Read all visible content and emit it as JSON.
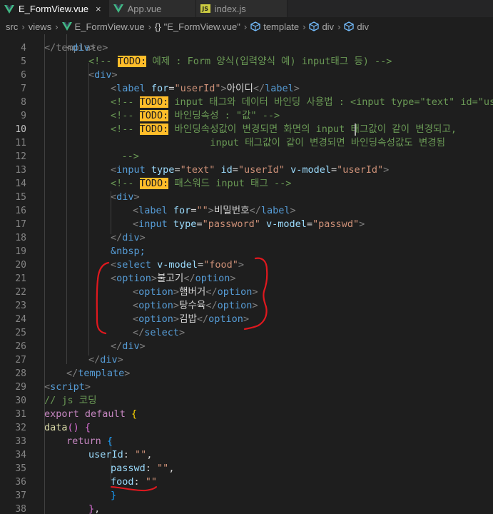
{
  "tabs": [
    {
      "label": "E_FormView.vue",
      "active": true,
      "icon": "vue-icon"
    },
    {
      "label": "App.vue",
      "active": false,
      "icon": "vue-icon"
    },
    {
      "label": "index.js",
      "active": false,
      "icon": "js-icon"
    }
  ],
  "js_badge": "JS",
  "close_glyph": "×",
  "breadcrumb": [
    "src",
    "views",
    "E_FormView.vue",
    "\"E_FormView.vue\"",
    "template",
    "div",
    "div"
  ],
  "breadcrumb_sep": "›",
  "breadcrumb_braces": "{}",
  "colors": {
    "annotation": "#e0181e",
    "todo_bg": "#ffbd2a",
    "vue": "#41b883"
  },
  "partial_top_line": "</template>",
  "lines": [
    {
      "n": "4",
      "t": [
        [
          "tag",
          "<"
        ],
        [
          "tn",
          "div"
        ],
        [
          "tag",
          ">"
        ]
      ]
    },
    {
      "n": "5",
      "t": [
        [
          "cm",
          "<!-- "
        ],
        [
          "todo",
          "TODO:"
        ],
        [
          "cm",
          " 예제 : Form 양식(입력양식 예) input태그 등) -->"
        ]
      ]
    },
    {
      "n": "6",
      "t": [
        [
          "tag",
          "<"
        ],
        [
          "tn",
          "div"
        ],
        [
          "tag",
          ">"
        ]
      ]
    },
    {
      "n": "7",
      "t": [
        [
          "tag",
          "<"
        ],
        [
          "tn",
          "label"
        ],
        [
          "tx",
          " "
        ],
        [
          "an",
          "for"
        ],
        [
          "tx",
          "="
        ],
        [
          "av",
          "\"userId\""
        ],
        [
          "tag",
          ">"
        ],
        [
          "tx",
          "아이디"
        ],
        [
          "tag",
          "</"
        ],
        [
          "tn",
          "label"
        ],
        [
          "tag",
          ">"
        ]
      ]
    },
    {
      "n": "8",
      "t": [
        [
          "cm",
          "<!-- "
        ],
        [
          "todo",
          "TODO:"
        ],
        [
          "cm",
          " input 태그와 데이터 바인딩 사용법 : <input type=\"text\" id=\"us"
        ]
      ]
    },
    {
      "n": "9",
      "t": [
        [
          "cm",
          "<!-- "
        ],
        [
          "todo",
          "TODO:"
        ],
        [
          "cm",
          " 바인딩속성 : \"값\" -->"
        ]
      ]
    },
    {
      "n": "10",
      "t": [
        [
          "cm",
          "<!-- "
        ],
        [
          "todo",
          "TODO:"
        ],
        [
          "cm",
          " 바인딩속성값이 변경되면 화면의 input 태그값이 같이 변경되고,"
        ]
      ]
    },
    {
      "n": "11",
      "t": [
        [
          "cm",
          "        input 태그값이 같이 변경되면 바인딩속성값도 변경됨"
        ]
      ]
    },
    {
      "n": "12",
      "t": [
        [
          "cm",
          "-->"
        ]
      ]
    },
    {
      "n": "13",
      "t": [
        [
          "tag",
          "<"
        ],
        [
          "tn",
          "input"
        ],
        [
          "tx",
          " "
        ],
        [
          "an",
          "type"
        ],
        [
          "tx",
          "="
        ],
        [
          "av",
          "\"text\""
        ],
        [
          "tx",
          " "
        ],
        [
          "an",
          "id"
        ],
        [
          "tx",
          "="
        ],
        [
          "av",
          "\"userId\""
        ],
        [
          "tx",
          " "
        ],
        [
          "an",
          "v-model"
        ],
        [
          "tx",
          "="
        ],
        [
          "av",
          "\"userId\""
        ],
        [
          "tag",
          ">"
        ]
      ]
    },
    {
      "n": "14",
      "t": [
        [
          "cm",
          "<!-- "
        ],
        [
          "todo",
          "TODO:"
        ],
        [
          "cm",
          " 패스워드 input 태그 -->"
        ]
      ]
    },
    {
      "n": "15",
      "t": [
        [
          "tag",
          "<"
        ],
        [
          "tn",
          "div"
        ],
        [
          "tag",
          ">"
        ]
      ]
    },
    {
      "n": "16",
      "t": [
        [
          "tag",
          "<"
        ],
        [
          "tn",
          "label"
        ],
        [
          "tx",
          " "
        ],
        [
          "an",
          "for"
        ],
        [
          "tx",
          "="
        ],
        [
          "av",
          "\"\""
        ],
        [
          "tag",
          ">"
        ],
        [
          "tx",
          "비밀번호"
        ],
        [
          "tag",
          "</"
        ],
        [
          "tn",
          "label"
        ],
        [
          "tag",
          ">"
        ]
      ]
    },
    {
      "n": "17",
      "t": [
        [
          "tag",
          "<"
        ],
        [
          "tn",
          "input"
        ],
        [
          "tx",
          " "
        ],
        [
          "an",
          "type"
        ],
        [
          "tx",
          "="
        ],
        [
          "av",
          "\"password\""
        ],
        [
          "tx",
          " "
        ],
        [
          "an",
          "v-model"
        ],
        [
          "tx",
          "="
        ],
        [
          "av",
          "\"passwd\""
        ],
        [
          "tag",
          ">"
        ]
      ]
    },
    {
      "n": "18",
      "t": [
        [
          "tag",
          "</"
        ],
        [
          "tn",
          "div"
        ],
        [
          "tag",
          ">"
        ]
      ]
    },
    {
      "n": "19",
      "t": [
        [
          "ent",
          "&nbsp;"
        ]
      ]
    },
    {
      "n": "20",
      "t": [
        [
          "tag",
          "<"
        ],
        [
          "tn",
          "select"
        ],
        [
          "tx",
          " "
        ],
        [
          "an",
          "v-model"
        ],
        [
          "tx",
          "="
        ],
        [
          "av",
          "\"food\""
        ],
        [
          "tag",
          ">"
        ]
      ]
    },
    {
      "n": "21",
      "t": [
        [
          "tag",
          "<"
        ],
        [
          "tn",
          "option"
        ],
        [
          "tag",
          ">"
        ],
        [
          "tx",
          "불고기"
        ],
        [
          "tag",
          "</"
        ],
        [
          "tn",
          "option"
        ],
        [
          "tag",
          ">"
        ]
      ]
    },
    {
      "n": "22",
      "t": [
        [
          "tag",
          "<"
        ],
        [
          "tn",
          "option"
        ],
        [
          "tag",
          ">"
        ],
        [
          "tx",
          "햄버거"
        ],
        [
          "tag",
          "</"
        ],
        [
          "tn",
          "option"
        ],
        [
          "tag",
          ">"
        ]
      ]
    },
    {
      "n": "23",
      "t": [
        [
          "tag",
          "<"
        ],
        [
          "tn",
          "option"
        ],
        [
          "tag",
          ">"
        ],
        [
          "tx",
          "탕수육"
        ],
        [
          "tag",
          "</"
        ],
        [
          "tn",
          "option"
        ],
        [
          "tag",
          ">"
        ]
      ]
    },
    {
      "n": "24",
      "t": [
        [
          "tag",
          "<"
        ],
        [
          "tn",
          "option"
        ],
        [
          "tag",
          ">"
        ],
        [
          "tx",
          "김밥"
        ],
        [
          "tag",
          "</"
        ],
        [
          "tn",
          "option"
        ],
        [
          "tag",
          ">"
        ]
      ]
    },
    {
      "n": "25",
      "t": [
        [
          "tag",
          "</"
        ],
        [
          "tn",
          "select"
        ],
        [
          "tag",
          ">"
        ]
      ]
    },
    {
      "n": "26",
      "t": [
        [
          "tag",
          "</"
        ],
        [
          "tn",
          "div"
        ],
        [
          "tag",
          ">"
        ]
      ]
    },
    {
      "n": "27",
      "t": [
        [
          "tag",
          "</"
        ],
        [
          "tn",
          "div"
        ],
        [
          "tag",
          ">"
        ]
      ]
    },
    {
      "n": "28",
      "t": [
        [
          "tag",
          "</"
        ],
        [
          "tn",
          "template"
        ],
        [
          "tag",
          ">"
        ]
      ]
    },
    {
      "n": "29",
      "t": [
        [
          "tag",
          "<"
        ],
        [
          "tn",
          "script"
        ],
        [
          "tag",
          ">"
        ]
      ]
    },
    {
      "n": "30",
      "t": [
        [
          "cm",
          "// js 코딩"
        ]
      ]
    },
    {
      "n": "31",
      "t": [
        [
          "kw",
          "export"
        ],
        [
          "tx",
          " "
        ],
        [
          "kw",
          "default"
        ],
        [
          "tx",
          " "
        ],
        [
          "br1",
          "{"
        ]
      ]
    },
    {
      "n": "32",
      "t": [
        [
          "fn",
          "data"
        ],
        [
          "br2",
          "()"
        ],
        [
          "tx",
          " "
        ],
        [
          "br2",
          "{"
        ]
      ]
    },
    {
      "n": "33",
      "t": [
        [
          "kw",
          "return"
        ],
        [
          "tx",
          " "
        ],
        [
          "br3",
          "{"
        ]
      ]
    },
    {
      "n": "34",
      "t": [
        [
          "pn",
          "userId"
        ],
        [
          "tx",
          ": "
        ],
        [
          "av",
          "\"\""
        ],
        [
          "tx",
          ","
        ]
      ]
    },
    {
      "n": "35",
      "t": [
        [
          "pn",
          "passwd"
        ],
        [
          "tx",
          ": "
        ],
        [
          "av",
          "\"\""
        ],
        [
          "tx",
          ","
        ]
      ]
    },
    {
      "n": "36",
      "t": [
        [
          "pn",
          "food"
        ],
        [
          "tx",
          ": "
        ],
        [
          "av",
          "\"\""
        ]
      ]
    },
    {
      "n": "37",
      "t": [
        [
          "br3",
          "}"
        ]
      ]
    },
    {
      "n": "38",
      "t": [
        [
          "br2",
          "}"
        ],
        [
          "tx",
          ","
        ]
      ]
    }
  ]
}
